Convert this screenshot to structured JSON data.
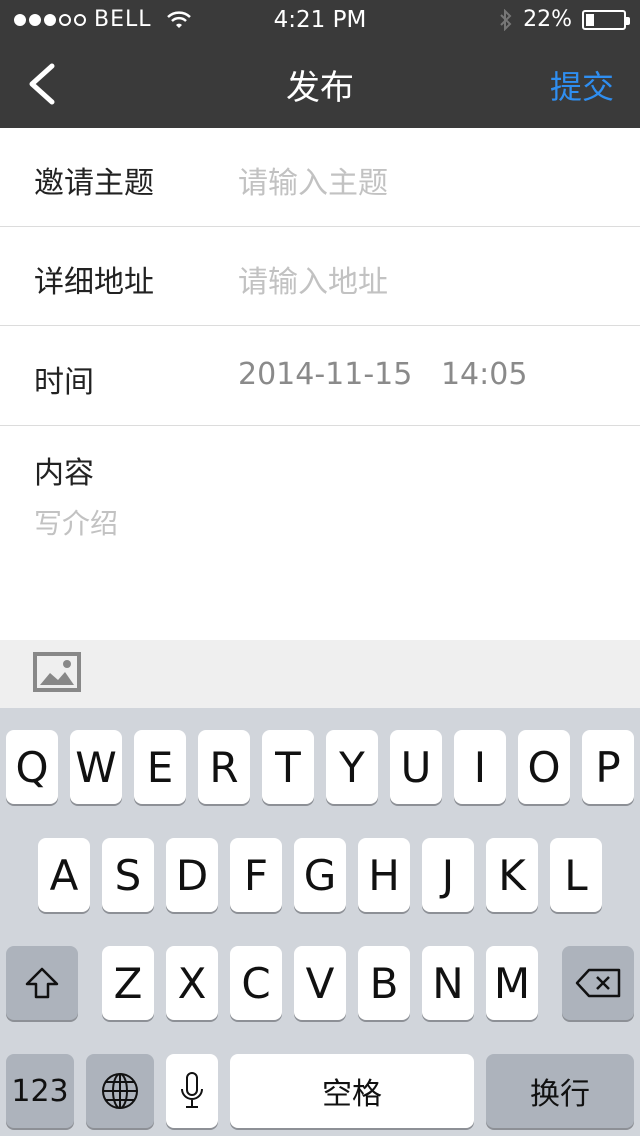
{
  "status_bar": {
    "carrier": "BELL",
    "time": "4:21 PM",
    "battery": "22%",
    "battery_level": 0.22,
    "signal_bars": 3
  },
  "nav": {
    "title": "发布",
    "submit_label": "提交"
  },
  "form": {
    "rows": [
      {
        "label": "邀请主题",
        "placeholder": "请输入主题"
      },
      {
        "label": "详细地址",
        "placeholder": "请输入地址"
      },
      {
        "label": "时间",
        "value": "2014-11-15   14:05"
      }
    ],
    "content_label": "内容",
    "content_placeholder": "写介绍"
  },
  "keyboard": {
    "row1": [
      "Q",
      "W",
      "E",
      "R",
      "T",
      "Y",
      "U",
      "I",
      "O",
      "P"
    ],
    "row2": [
      "A",
      "S",
      "D",
      "F",
      "G",
      "H",
      "J",
      "K",
      "L"
    ],
    "row3": [
      "Z",
      "X",
      "C",
      "V",
      "B",
      "N",
      "M"
    ],
    "numbers_label": "123",
    "space_label": "空格",
    "return_label": "换行"
  },
  "colors": {
    "bar_background": "#3a3a3a",
    "accent": "#2f8ef0",
    "keyboard_background": "#d1d5db"
  }
}
